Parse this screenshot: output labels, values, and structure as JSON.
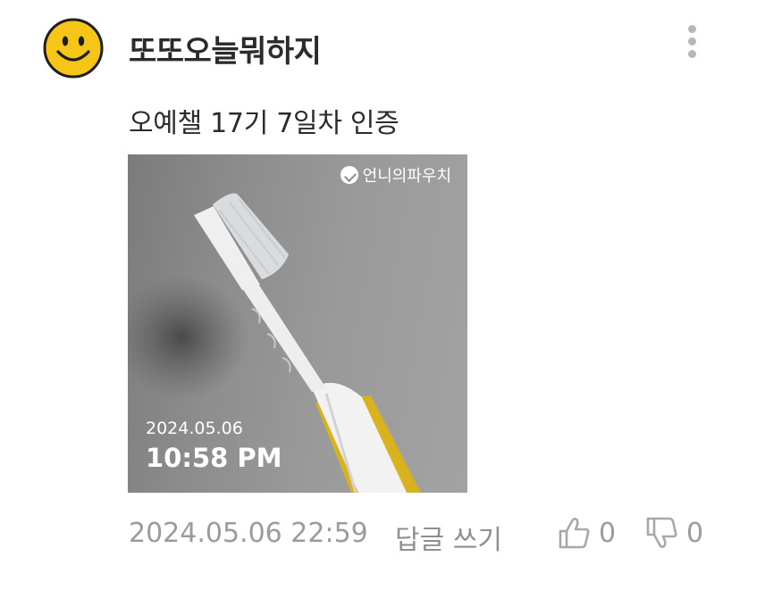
{
  "author": {
    "name": "또또오늘뭐하지",
    "avatar_icon": "smiley-face-icon",
    "avatar_color": "#F5C518"
  },
  "menu": {
    "icon": "more-vertical-icon"
  },
  "post": {
    "text": "오예챌 17기 7일차 인증"
  },
  "photo": {
    "watermark": "언니의파우치",
    "date": "2024.05.06",
    "time": "10:58 PM"
  },
  "footer": {
    "timestamp": "2024.05.06 22:59",
    "reply_label": "답글 쓰기",
    "like_count": "0",
    "dislike_count": "0",
    "like_icon": "thumbs-up-icon",
    "dislike_icon": "thumbs-down-icon"
  }
}
